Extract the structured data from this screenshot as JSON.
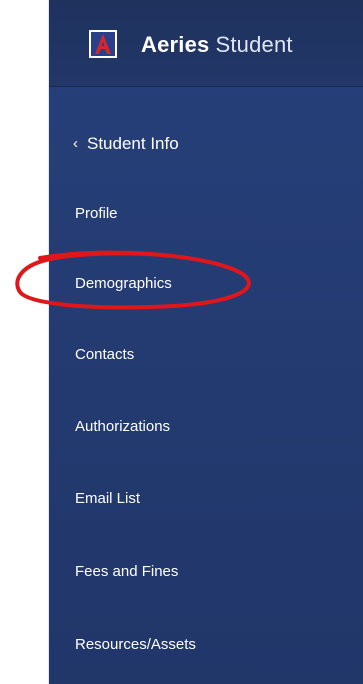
{
  "brand": {
    "name_bold": "Aeries",
    "name_light": "Student",
    "logo_icon": "aeries-logo-icon"
  },
  "back": {
    "label": "Student Info",
    "icon": "chevron-left-icon"
  },
  "nav": {
    "items": [
      {
        "label": "Profile"
      },
      {
        "label": "Demographics",
        "highlighted": true
      },
      {
        "label": "Contacts"
      },
      {
        "label": "Authorizations"
      },
      {
        "label": "Email List"
      },
      {
        "label": "Fees and Fines"
      },
      {
        "label": "Resources/Assets"
      }
    ]
  },
  "colors": {
    "sidebar": "#233a70",
    "header": "#1f325e",
    "text": "#ffffff",
    "logo_red": "#d9252a",
    "annotation_red": "#e0161b"
  }
}
